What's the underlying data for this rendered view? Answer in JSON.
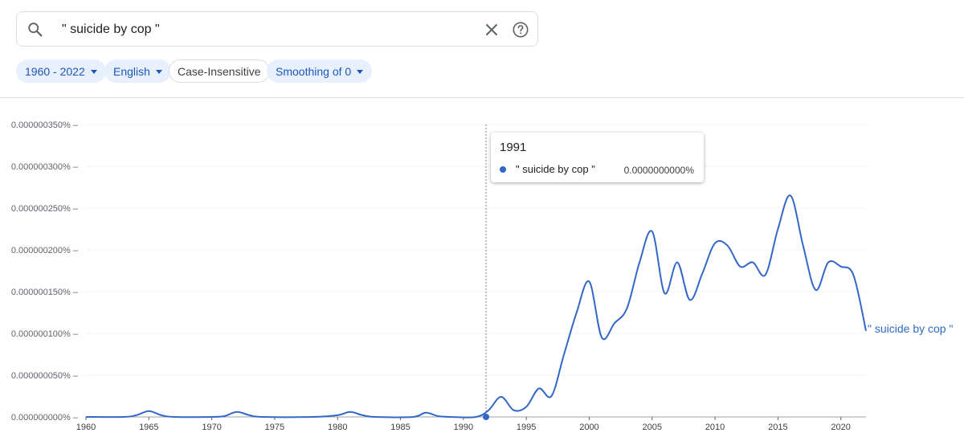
{
  "search": {
    "query": "\" suicide by cop \""
  },
  "filters": {
    "year_range": "1960 - 2022",
    "corpus": "English",
    "case": "Case-Insensitive",
    "smoothing": "Smoothing of 0"
  },
  "colors": {
    "series": "#3367c8",
    "chip_bg": "#e8f0fe",
    "chip_text": "#1a57b8"
  },
  "tooltip": {
    "year": "1991",
    "series_name": "\" suicide by cop \"",
    "value": "0.0000000000%"
  },
  "chart_data": {
    "type": "line",
    "xlabel": "",
    "ylabel": "",
    "xlim": [
      1960,
      2022
    ],
    "ylim": [
      0,
      3.5e-07
    ],
    "x_ticks": [
      1960,
      1965,
      1970,
      1975,
      1980,
      1985,
      1990,
      1995,
      2000,
      2005,
      2010,
      2015,
      2020
    ],
    "y_tick_labels": [
      "0.000000000%",
      "0.000000050%",
      "0.000000100%",
      "0.000000150%",
      "0.000000200%",
      "0.000000250%",
      "0.000000300%",
      "0.000000350%"
    ],
    "y_tick_values": [
      0,
      5e-08,
      1e-07,
      1.5e-07,
      2e-07,
      2.5e-07,
      3e-07,
      3.5e-07
    ],
    "hover_year": 1991.8,
    "series": [
      {
        "name": "\" suicide by cop \"",
        "x": [
          1960,
          1963,
          1964,
          1965,
          1966,
          1967,
          1970,
          1971,
          1972,
          1973,
          1974,
          1978,
          1980,
          1981,
          1982,
          1983,
          1986,
          1987,
          1988,
          1989,
          1991,
          1992,
          1993,
          1994,
          1995,
          1996,
          1997,
          1998,
          1999,
          2000,
          2001,
          2002,
          2003,
          2004,
          2005,
          2006,
          2007,
          2008,
          2009,
          2010,
          2011,
          2012,
          2013,
          2014,
          2015,
          2016,
          2017,
          2018,
          2019,
          2020,
          2021,
          2022
        ],
        "y": [
          0,
          0,
          2e-09,
          7e-09,
          2e-09,
          0,
          0,
          1e-09,
          6e-09,
          2e-09,
          0,
          0,
          2e-09,
          6e-09,
          2e-09,
          0,
          0,
          5e-09,
          1e-09,
          0,
          0,
          8e-09,
          2.4e-08,
          8e-09,
          1.2e-08,
          3.4e-08,
          2.5e-08,
          7.5e-08,
          1.25e-07,
          1.62e-07,
          9.5e-08,
          1.12e-07,
          1.3e-07,
          1.85e-07,
          2.22e-07,
          1.48e-07,
          1.85e-07,
          1.4e-07,
          1.72e-07,
          2.08e-07,
          2.05e-07,
          1.8e-07,
          1.85e-07,
          1.7e-07,
          2.25e-07,
          2.65e-07,
          2.05e-07,
          1.52e-07,
          1.85e-07,
          1.8e-07,
          1.7e-07,
          1.03e-07
        ]
      }
    ]
  }
}
